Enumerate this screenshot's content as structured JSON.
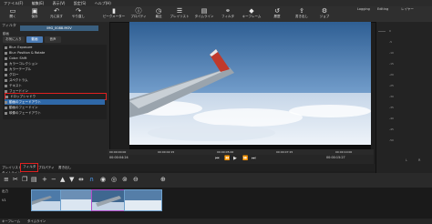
{
  "menu": [
    "ファイル(F)",
    "編集(E)",
    "表示(V)",
    "設定(S)",
    "ヘルプ(H)"
  ],
  "toolbar": {
    "items": [
      {
        "label": "開く",
        "icon": "folder-icon"
      },
      {
        "label": "保存",
        "icon": "save-icon"
      },
      {
        "label": "元に戻す",
        "icon": "undo-icon"
      },
      {
        "label": "やり直し",
        "icon": "redo-icon"
      },
      {
        "label": "ピークメーター",
        "icon": "meter-icon"
      },
      {
        "label": "プロパティ",
        "icon": "info-icon"
      },
      {
        "label": "最近",
        "icon": "clock-icon"
      },
      {
        "label": "プレイリスト",
        "icon": "playlist-icon"
      },
      {
        "label": "タイムライン",
        "icon": "timeline-icon"
      },
      {
        "label": "フィルタ",
        "icon": "filter-icon"
      },
      {
        "label": "キーフレーム",
        "icon": "keyframe-icon"
      },
      {
        "label": "履歴",
        "icon": "history-icon"
      },
      {
        "label": "書き出し",
        "icon": "export-icon"
      },
      {
        "label": "ジョブ",
        "icon": "jobs-icon"
      }
    ],
    "logging": "Logging",
    "editing": "Editing",
    "layout": "レイヤー"
  },
  "filters": {
    "panel_title": "フィルタ",
    "clip_name": "IMG_0088.MOV",
    "label": "動画",
    "tabs": [
      "お気に入り",
      "動画",
      "音声"
    ],
    "items": [
      "Blur: Exposure",
      "Blur: Position & Rotate",
      "Color: Shift",
      "カラーコレクション",
      "カラーテーブル",
      "グロー",
      "スペクトラム",
      "テキスト",
      "フェードイン",
      "ドロップシャドウ",
      "動画のフェードアウト",
      "動画のフェードイン",
      "映像のフェードアウト",
      "音声のフェードイン",
      "音声のフェードアウト",
      "動画 サイズ"
    ],
    "selected_index": 10
  },
  "player": {
    "timecodes": [
      "00:00:00:00",
      "00:00:02:15",
      "00:00:05:00",
      "00:00:07:15",
      "00:00:10:00"
    ],
    "current": "00:00:04:24",
    "duration": "00:00:15:27",
    "source_tab": "ソース",
    "project_tab": "プロジェクト"
  },
  "audio_meter": {
    "ticks": [
      "0",
      "-5",
      "-10",
      "-15",
      "-20",
      "-25",
      "-30",
      "-35",
      "-40",
      "-45",
      "-50"
    ],
    "label_l": "L",
    "label_r": "R"
  },
  "bottom_tabs": {
    "playlist": "プレイリスト",
    "filter": "フィルタ",
    "properties": "プロパティ",
    "export": "書き出し"
  },
  "timeline": {
    "title": "タイムライン",
    "track_v": "V1",
    "track_label": "出力"
  },
  "status": {
    "left": "キーフレーム",
    "right": "タイムライン"
  }
}
